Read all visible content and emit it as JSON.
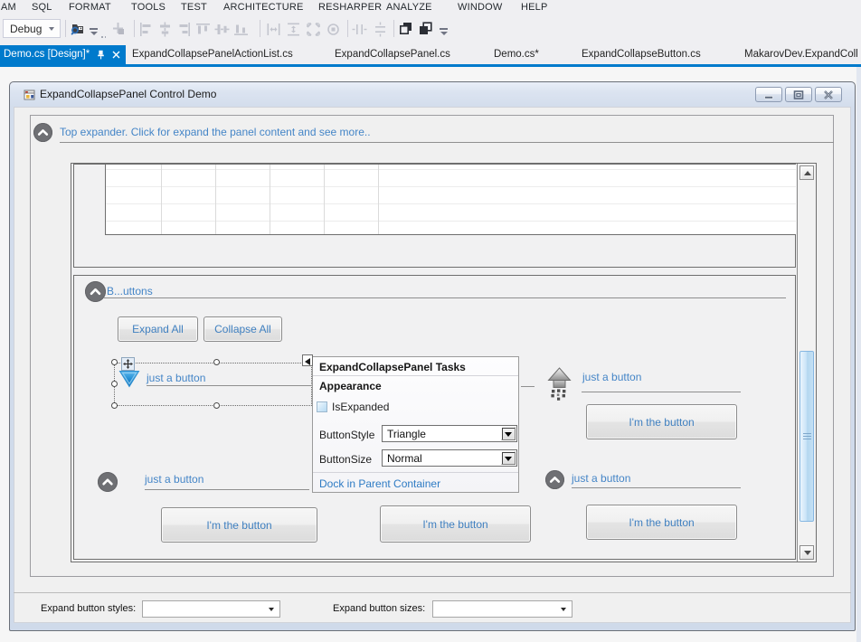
{
  "menu": {
    "items": [
      {
        "label": "AM"
      },
      {
        "label": "SQL"
      },
      {
        "label": "FORMAT"
      },
      {
        "label": "TOOLS"
      },
      {
        "label": "TEST"
      },
      {
        "label": "ARCHITECTURE"
      },
      {
        "label": "RESHARPER"
      },
      {
        "label": "ANALYZE"
      },
      {
        "label": "WINDOW"
      },
      {
        "label": "HELP"
      }
    ]
  },
  "toolbar": {
    "debug_combo_value": "Debug",
    "icons": [
      "find-in-files-icon",
      "toolbar-overflow-icon",
      "align-to-grid-icon",
      "align-lefts-icon",
      "align-centers-icon",
      "align-rights-icon",
      "align-tops-icon",
      "align-middles-icon",
      "align-bottoms-icon",
      "make-same-width-icon",
      "make-same-height-icon",
      "make-same-size-icon",
      "size-to-grid-icon",
      "horizontal-spacing-icon",
      "vertical-spacing-icon",
      "bring-to-front-icon",
      "send-to-back-icon"
    ]
  },
  "tabs": {
    "active": {
      "label": "Demo.cs [Design]*"
    },
    "inactive": [
      {
        "label": "ExpandCollapsePanelActionList.cs"
      },
      {
        "label": "ExpandCollapsePanel.cs"
      },
      {
        "label": "Demo.cs*"
      },
      {
        "label": "ExpandCollapseButton.cs"
      },
      {
        "label": "MakarovDev.ExpandColl"
      }
    ]
  },
  "window": {
    "title": "ExpandCollapsePanel Control Demo",
    "controls": [
      "minimize",
      "maximize",
      "close"
    ]
  },
  "top_expander": {
    "label": "Top expander. Click for expand the panel content and see more.."
  },
  "buttons_expander": {
    "label": "B...uttons",
    "expand_all": "Expand All",
    "collapse_all": "Collapse All"
  },
  "expanders": {
    "selected_label": "just a button",
    "arrow_label": "just a button",
    "bottom_left_label": "just a button",
    "bottom_right_label": "just a button",
    "button_text": "I'm the button"
  },
  "task_panel": {
    "title": "ExpandCollapsePanel Tasks",
    "section": "Appearance",
    "checkbox_label": "IsExpanded",
    "rows": [
      {
        "label": "ButtonStyle",
        "value": "Triangle"
      },
      {
        "label": "ButtonSize",
        "value": "Normal"
      }
    ],
    "link": "Dock in Parent Container"
  },
  "bottom_bar": {
    "styles_label": "Expand button styles:",
    "sizes_label": "Expand button sizes:"
  },
  "colors": {
    "accent": "#007ACC",
    "chrome_background": "#EFEFF2",
    "form_client": "#F0F0F0",
    "blue_label": "#4485C7",
    "title_gradient_top": "#F0F4FB",
    "title_gradient_bottom": "#CED9EA",
    "selection_thumb_blue": "#CBE4F7"
  }
}
